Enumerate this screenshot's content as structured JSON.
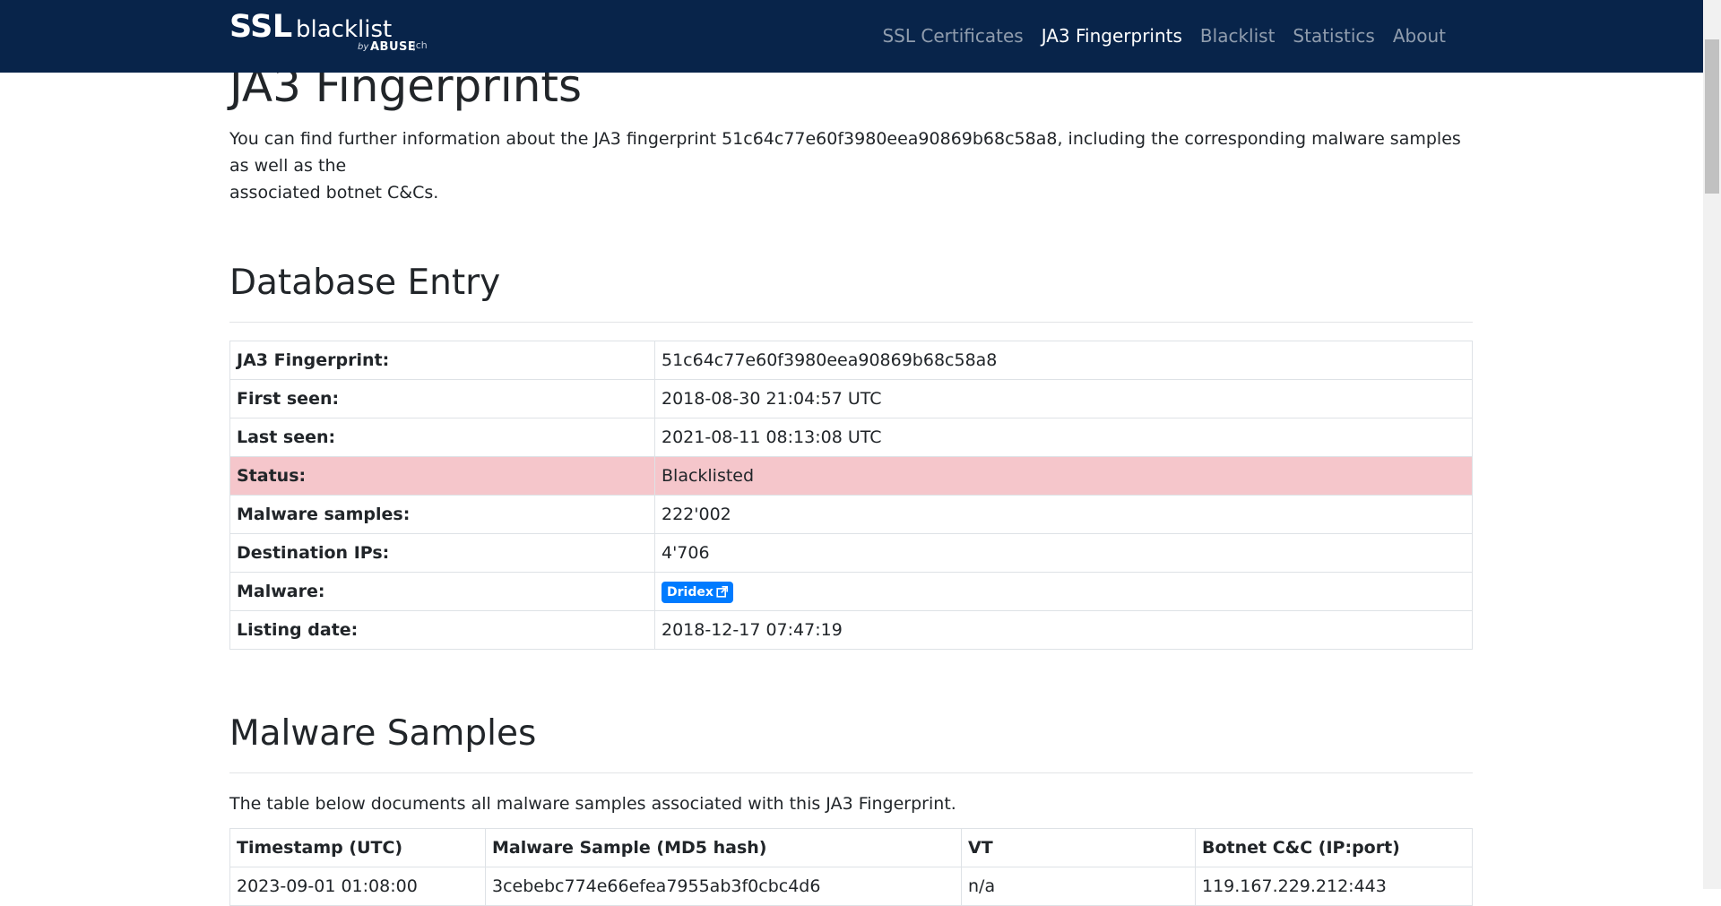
{
  "brand": {
    "ssl": "SSL",
    "blacklist": "blacklist",
    "by": "by",
    "abuse": "ABUSE",
    "ch": "|ch"
  },
  "nav": {
    "items": [
      {
        "label": "SSL Certificates"
      },
      {
        "label": "JA3 Fingerprints",
        "active": true
      },
      {
        "label": "Blacklist"
      },
      {
        "label": "Statistics"
      },
      {
        "label": "About"
      }
    ]
  },
  "page": {
    "title": "JA3 Fingerprints",
    "intro_line1": "You can find further information about the JA3 fingerprint 51c64c77e60f3980eea90869b68c58a8, including the corresponding malware samples as well as the",
    "intro_line2": "associated botnet C&Cs."
  },
  "database_entry": {
    "title": "Database Entry",
    "rows": [
      {
        "key": "JA3 Fingerprint:",
        "value": "51c64c77e60f3980eea90869b68c58a8"
      },
      {
        "key": "First seen:",
        "value": "2018-08-30 21:04:57 UTC"
      },
      {
        "key": "Last seen:",
        "value": "2021-08-11 08:13:08 UTC"
      },
      {
        "key": "Status:",
        "value": "Blacklisted",
        "highlight_color": "#f5c6cb"
      },
      {
        "key": "Malware samples:",
        "value": "222'002"
      },
      {
        "key": "Destination IPs:",
        "value": "4'706"
      },
      {
        "key": "Malware:",
        "badge": "Dridex",
        "badge_color": "#007bff",
        "icon": "external-link-icon"
      },
      {
        "key": "Listing date:",
        "value": "2018-12-17 07:47:19"
      }
    ]
  },
  "malware_samples": {
    "title": "Malware Samples",
    "description": "The table below documents all malware samples associated with this JA3 Fingerprint.",
    "columns": [
      "Timestamp (UTC)",
      "Malware Sample (MD5 hash)",
      "VT",
      "Botnet C&C (IP:port)"
    ],
    "rows": [
      [
        "2023-09-01 01:08:00",
        "3cebebc774e66efea7955ab3f0cbc4d6",
        "n/a",
        "119.167.229.212:443"
      ]
    ]
  },
  "colors": {
    "navbar": "#08244a",
    "badge": "#007bff",
    "danger_row": "#f5c6cb"
  }
}
